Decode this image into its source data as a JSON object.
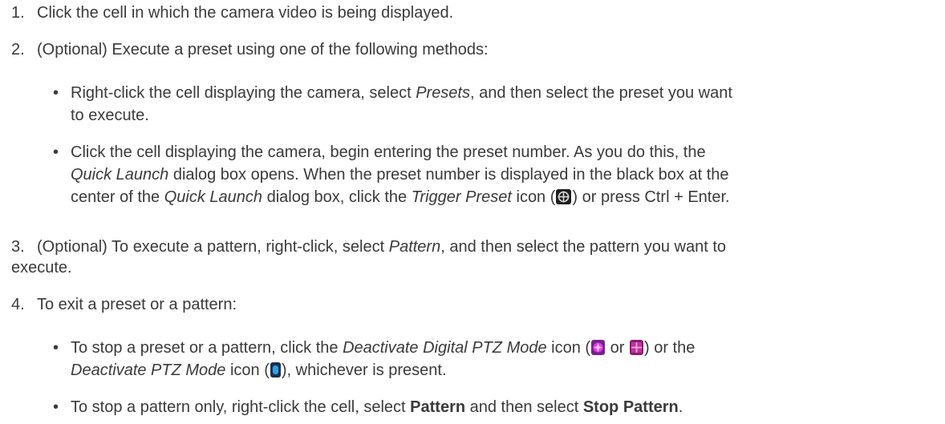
{
  "steps": [
    {
      "number": "1.",
      "text": "Click the cell in which the camera video is being displayed."
    },
    {
      "number": "2.",
      "text": "(Optional) Execute a preset using one of the following methods:"
    },
    {
      "number": "3.",
      "line1_a": "(Optional) To execute a pattern, right-click, select ",
      "line1_em": "Pattern",
      "line1_b": ", and then select the pattern you want to",
      "line2": "execute."
    },
    {
      "number": "4.",
      "text": "To exit a preset or a pattern:"
    }
  ],
  "step2_bullets": [
    {
      "line1_a": "Right-click the cell displaying the camera, select ",
      "line1_em": "Presets",
      "line1_b": ", and then select the preset you want",
      "line2": "to execute."
    },
    {
      "line1": "Click the cell displaying the camera, begin entering the preset number. As you do this, the",
      "line2_em": "Quick Launch",
      "line2_b": " dialog box opens. When the preset number is displayed in the black box at the",
      "line3_a": "center of the ",
      "line3_em1": "Quick Launch",
      "line3_b": " dialog box, click the ",
      "line3_em2": "Trigger Preset",
      "line3_c": " icon (",
      "line3_d": ") or press Ctrl + Enter."
    }
  ],
  "step4_bullets": [
    {
      "line1_a": "To stop a preset or a pattern, click the ",
      "line1_em": "Deactivate Digital PTZ Mode",
      "line1_b": " icon (",
      "line1_or": " or ",
      "line1_c": ") or the",
      "line2_em": "Deactivate PTZ Mode",
      "line2_a": " icon (",
      "line2_b": "), whichever is present."
    },
    {
      "line1_a": "To stop a pattern only, right-click the cell, select ",
      "line1_strong1": "Pattern",
      "line1_b": " and then select ",
      "line1_strong2": "Stop Pattern",
      "line1_c": "."
    }
  ],
  "bullet_glyph": "•"
}
